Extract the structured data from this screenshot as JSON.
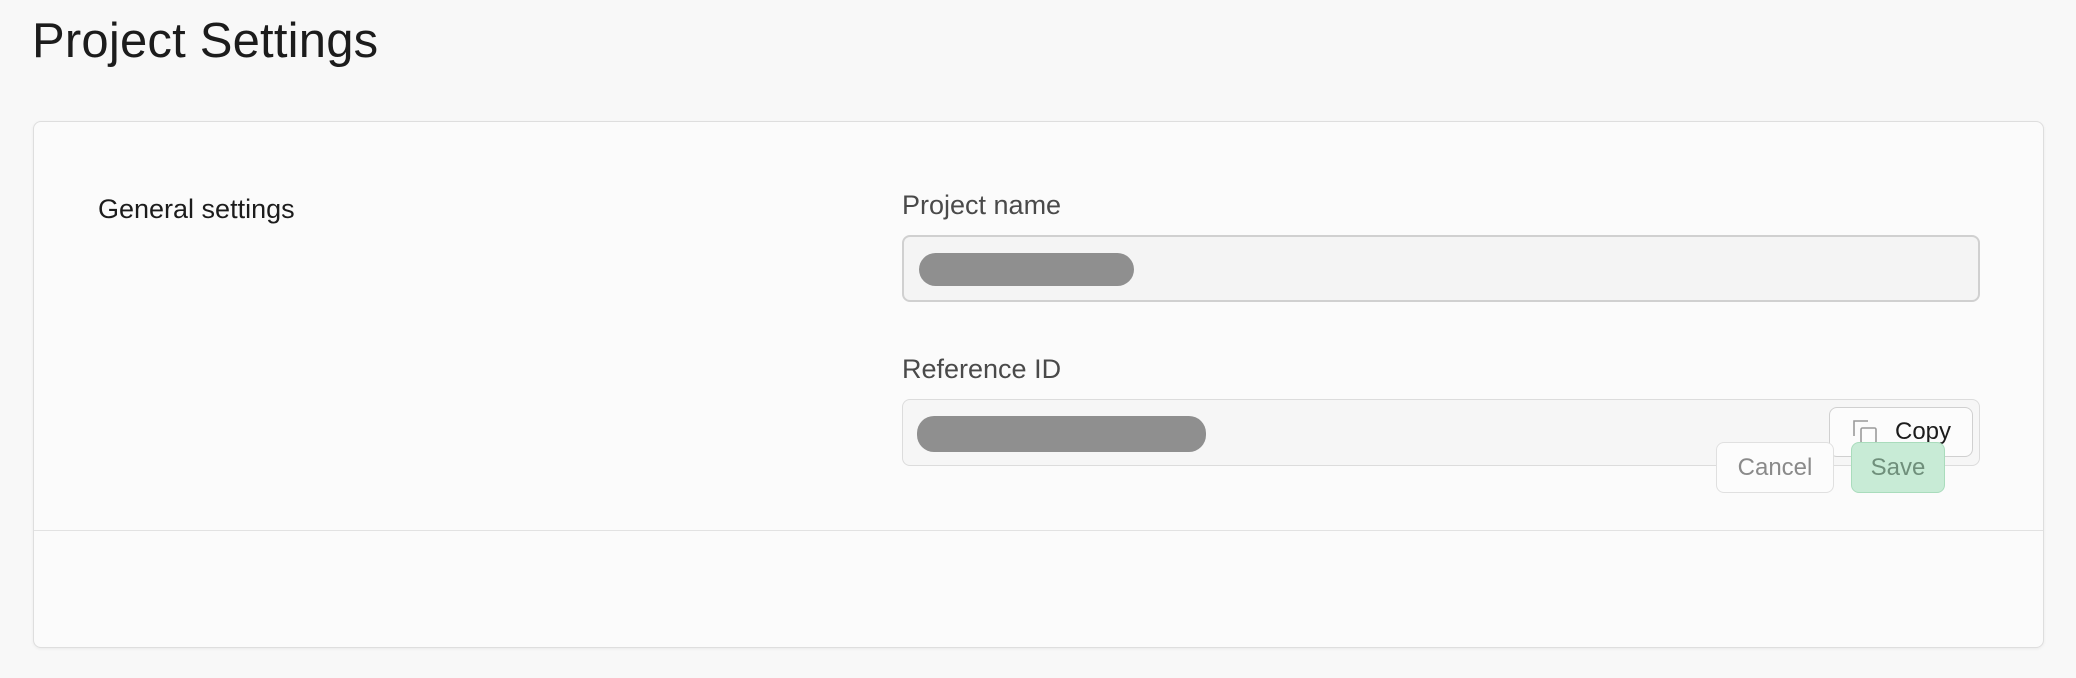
{
  "page": {
    "title": "Project Settings"
  },
  "general": {
    "section_title": "General settings",
    "project_name": {
      "label": "Project name",
      "value": ""
    },
    "reference_id": {
      "label": "Reference ID",
      "value": "",
      "copy_label": "Copy",
      "copy_icon": "copy-icon"
    }
  },
  "footer": {
    "cancel_label": "Cancel",
    "save_label": "Save"
  },
  "colors": {
    "background": "#f8f8f8",
    "card": "#fbfbfb",
    "save_fill": "#c8ebd6",
    "save_text": "#6f8f7b",
    "redacted": "#8f8f8f"
  }
}
